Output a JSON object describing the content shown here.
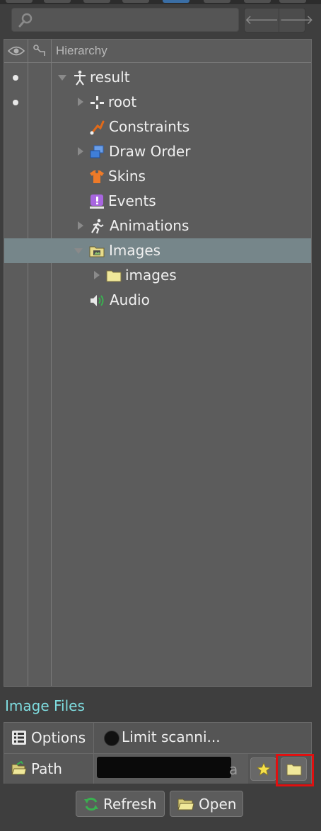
{
  "tree": {
    "header_title": "Hierarchy",
    "nodes": [
      {
        "label": "result",
        "icon": "skeleton-icon"
      },
      {
        "label": "root",
        "icon": "bone-icon"
      },
      {
        "label": "Constraints",
        "icon": "constraints-icon"
      },
      {
        "label": "Draw Order",
        "icon": "draw-order-icon"
      },
      {
        "label": "Skins",
        "icon": "skins-icon"
      },
      {
        "label": "Events",
        "icon": "events-icon"
      },
      {
        "label": "Animations",
        "icon": "animations-icon"
      },
      {
        "label": "Images",
        "icon": "images-folder-icon"
      },
      {
        "label": "images",
        "icon": "folder-icon"
      },
      {
        "label": "Audio",
        "icon": "audio-icon"
      }
    ]
  },
  "section_title": "Image Files",
  "properties": {
    "options_label": "Options",
    "limit_label": "Limit scanni...",
    "path_label": "Path",
    "path_value_suffix": "a"
  },
  "buttons": {
    "refresh": "Refresh",
    "open": "Open"
  },
  "colors": {
    "accent_title": "#7fdde0",
    "selected_row": "#76868a",
    "highlight": "#e01010"
  }
}
